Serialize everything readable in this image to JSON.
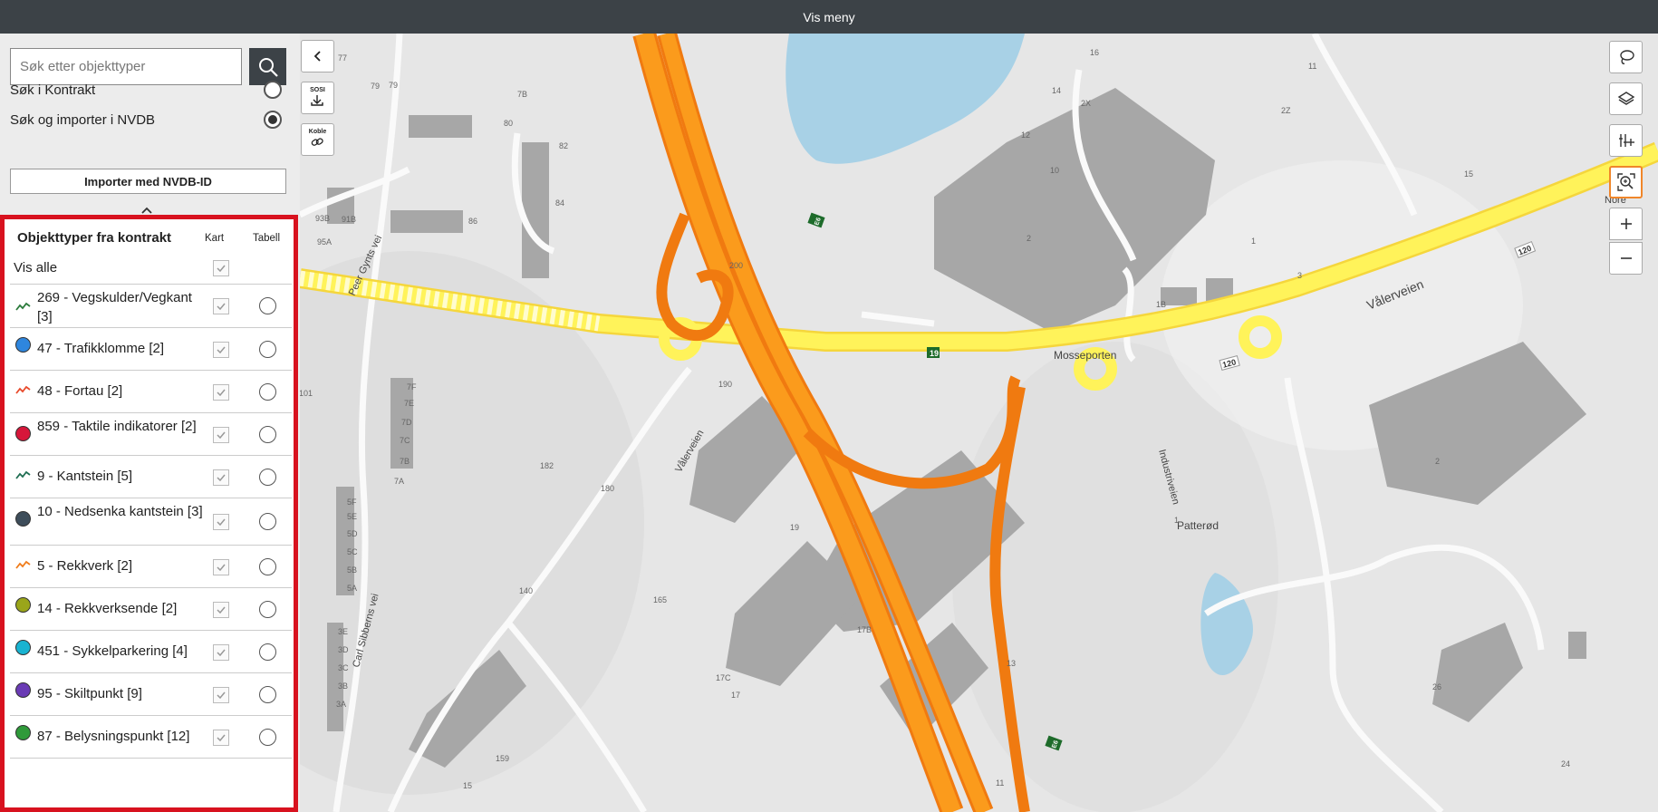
{
  "topbar": {
    "title": "Vis meny"
  },
  "search": {
    "placeholder": "Søk etter objekttyper",
    "option_contract": "Søk i Kontrakt",
    "option_nvdb": "Søk og importer i NVDB",
    "selected": "Søk og importer i NVDB"
  },
  "import_button": "Importer med NVDB-ID",
  "panel": {
    "title": "Objekttyper fra kontrakt",
    "col_map": "Kart",
    "col_table": "Tabell",
    "show_all": "Vis alle",
    "items": [
      {
        "label": "269 - Vegskulder/Vegkant [3]",
        "icon": "line-icon",
        "color": "#2a7a3a"
      },
      {
        "label": "47 - Trafikklomme [2]",
        "icon": "dot-icon",
        "color": "#2e86de"
      },
      {
        "label": "48 - Fortau [2]",
        "icon": "line-icon",
        "color": "#e84a2b"
      },
      {
        "label": "859 - Taktile indikatorer [2]",
        "icon": "dot-icon",
        "color": "#d6163a"
      },
      {
        "label": "9 - Kantstein [5]",
        "icon": "line-icon",
        "color": "#1f6e52"
      },
      {
        "label": "10 - Nedsenka kantstein [3]",
        "icon": "dot-icon",
        "color": "#3d4d5a"
      },
      {
        "label": "5 - Rekkverk [2]",
        "icon": "line-icon",
        "color": "#f07c1a"
      },
      {
        "label": "14 - Rekkverksende [2]",
        "icon": "dot-icon",
        "color": "#9aa51a"
      },
      {
        "label": "451 - Sykkelparkering [4]",
        "icon": "dot-icon",
        "color": "#19b3d1"
      },
      {
        "label": "95 - Skiltpunkt [9]",
        "icon": "dot-icon",
        "color": "#6a3bb5"
      },
      {
        "label": "87 - Belysningspunkt [12]",
        "icon": "dot-icon",
        "color": "#2f9a3a"
      }
    ]
  },
  "map_tools": {
    "sosi_label": "SOSI",
    "koble_label": "Koble"
  },
  "map_labels": {
    "road_valerveien": "Vålerveien",
    "road_industriveien": "Industriveien",
    "road_peer_gynts_vei": "Peer Gynts vei",
    "road_carl_sibberns_vei": "Carl Sibberns vei",
    "road_valerveien_small": "Vålerveien",
    "place_mosseporten": "Mosseporten",
    "place_patterod": "Patterød",
    "place_nore": "Nore",
    "shield_19": "19",
    "shield_120a": "120",
    "shield_120b": "120",
    "shield_e6a": "E6",
    "shield_e6b": "E6",
    "numbers": [
      "77",
      "79",
      "7B",
      "80",
      "82",
      "84",
      "86",
      "79",
      "93B",
      "91B",
      "95A",
      "200",
      "190",
      "182",
      "180",
      "165",
      "140",
      "159",
      "15",
      "17C",
      "17",
      "11",
      "17B",
      "13",
      "19",
      "7F",
      "7E",
      "7D",
      "7C",
      "7B",
      "7A",
      "5F",
      "5E",
      "5D",
      "5C",
      "5B",
      "5A",
      "3E",
      "3D",
      "3C",
      "3B",
      "3A",
      "101",
      "16",
      "14",
      "2X",
      "12",
      "10",
      "2",
      "11",
      "2Z",
      "15",
      "1",
      "3",
      "1B",
      "26",
      "24",
      "2",
      "1"
    ]
  }
}
